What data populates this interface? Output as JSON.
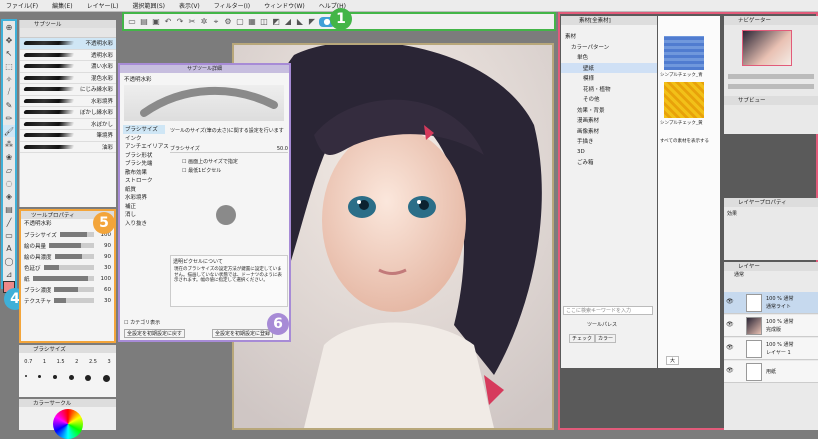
{
  "menu": [
    "ファイル(F)",
    "編集(E)",
    "レイヤー(L)",
    "選択範囲(S)",
    "表示(V)",
    "フィルター(I)",
    "ウィンドウ(W)",
    "ヘルプ(H)"
  ],
  "badges": {
    "command_bar": "1",
    "toolbox": "4",
    "tool_property": "5",
    "subtool_detail": "6"
  },
  "badge_colors": {
    "1": "#43b548",
    "4": "#3fb0d8",
    "5": "#f3a53b",
    "6": "#a78bd6"
  },
  "subtool": {
    "title": "サブツール",
    "brushes": [
      "不透明水彩",
      "透明水彩",
      "濃い水彩",
      "混色水彩",
      "にじみ縁水彩",
      "水彩境界",
      "ぼかし縁水彩",
      "水ぼかし",
      "筆境界",
      "油彩"
    ]
  },
  "tool_property": {
    "title": "ツールプロパティ",
    "subtitle": "不透明水彩",
    "rows": [
      {
        "label": "ブラシサイズ",
        "value": "100"
      },
      {
        "label": "絵の具量",
        "value": "90"
      },
      {
        "label": "絵の具濃度",
        "value": "90"
      },
      {
        "label": "色延び",
        "value": "30"
      },
      {
        "label": "紙",
        "value": "100"
      },
      {
        "label": "ブラシ濃度",
        "value": "60"
      },
      {
        "label": "テクスチャ",
        "value": "30"
      }
    ]
  },
  "brush_size_panel": {
    "title": "ブラシサイズ",
    "sizes": [
      "0.7",
      "1",
      "1.5",
      "2",
      "2.5",
      "3"
    ]
  },
  "color_panel": {
    "title": "カラーサークル"
  },
  "subtool_detail": {
    "title": "サブツール詳細",
    "subtitle": "不透明水彩",
    "categories": [
      "ブラシサイズ",
      "インク",
      "アンチエイリアス",
      "ブラシ形状",
      "ブラシ先端",
      "散布効果",
      "ストローク",
      "紙質",
      "水彩境界",
      "補正",
      "消し",
      "入り抜き"
    ],
    "description": "ツールのサイズ(筆の太さ)に関する設定を行います",
    "size_label": "ブラシサイズ",
    "size_value": "50.0",
    "option1": "画面上のサイズで指定",
    "option2": "最低1ピクセル",
    "help_title": "透明ピクセルについて",
    "help_text": "現在のブラシサイズの設定方法が鍵置に設定していません。描画していない状態では、ドーナツのように表示されます。幅の値に指定して選択ください。",
    "checkbox": "カテゴリ表示",
    "btn1": "全設定を初期設定に戻す",
    "btn2": "全設定を初期設定に登録"
  },
  "material_panel": {
    "title": "素材[全素材]",
    "tree": [
      "素材",
      "カラーパターン",
      "単色",
      "壁紙",
      "模様",
      "花柄・植物",
      "その他",
      "効果・背景",
      "漫画素材",
      "画像素材",
      "手描き",
      "3D",
      "ごみ箱"
    ],
    "selected_index": 3,
    "search_placeholder": "ここに検索キーワードを入力",
    "tag_btn": "ツールパレス",
    "btn_check": "チェック",
    "btn_color": "カラー",
    "thumb1_label": "シンプルチェック_青",
    "thumb2_label": "シンプルチェック_黄",
    "show_all": "すべての素材を表示する",
    "zoom_label": "大"
  },
  "navigator": {
    "title": "ナビゲーター"
  },
  "subview": {
    "title": "サブビュー"
  },
  "layer_property": {
    "title": "レイヤープロパティ",
    "effect_label": "効果"
  },
  "layers": {
    "title": "レイヤー",
    "blend_mode": "通常",
    "rows": [
      {
        "opacity": "100 %",
        "mode": "通常",
        "name": "通常ライト"
      },
      {
        "opacity": "100 %",
        "mode": "通常",
        "name": "完成版"
      },
      {
        "opacity": "100 %",
        "mode": "通常",
        "name": "レイヤー 1"
      },
      {
        "opacity": "",
        "mode": "",
        "name": "用紙"
      }
    ]
  }
}
